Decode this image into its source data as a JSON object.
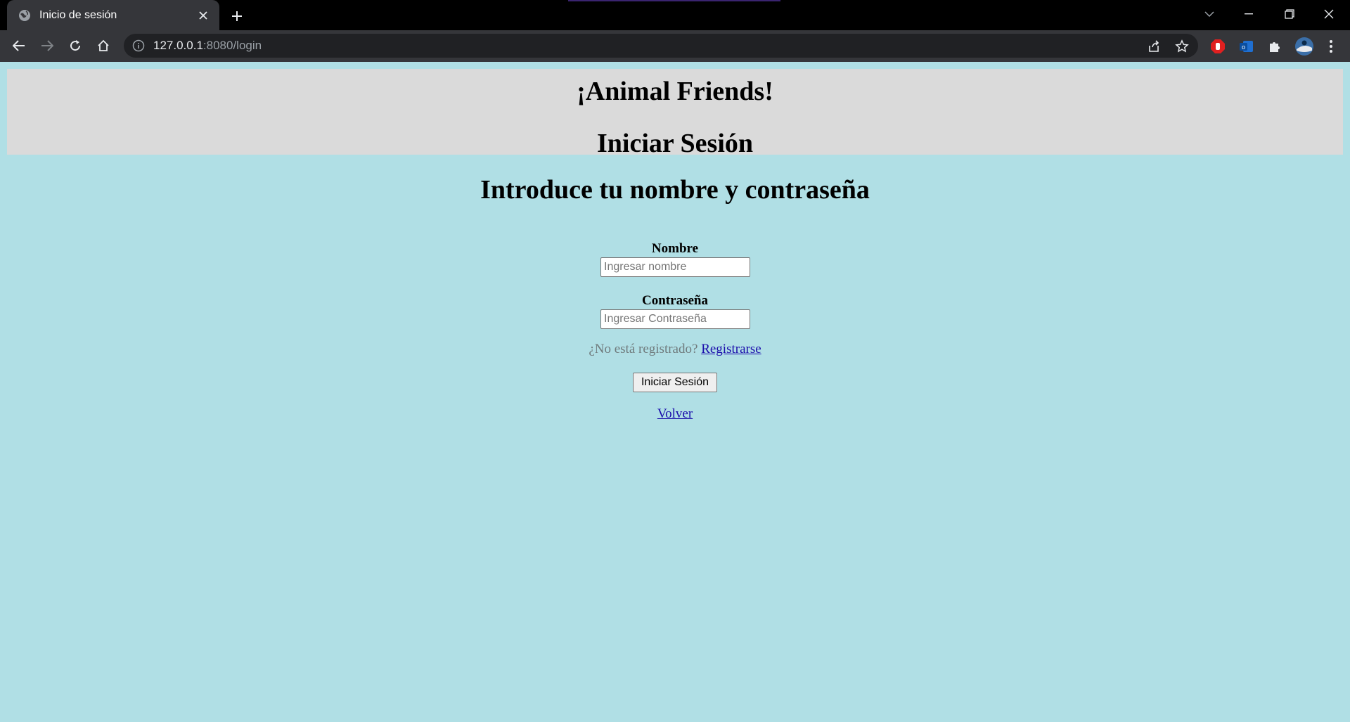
{
  "browser": {
    "tab_title": "Inicio de sesión",
    "url_host": "127.0.0.1",
    "url_rest": ":8080/login"
  },
  "page": {
    "site_title": "¡Animal Friends!",
    "heading": "Iniciar Sesión",
    "intro": "Introduce tu nombre y contraseña",
    "form": {
      "name_label": "Nombre",
      "name_placeholder": "Ingresar nombre",
      "password_label": "Contraseña",
      "password_placeholder": "Ingresar Contraseña",
      "not_registered_text": "¿No está registrado?",
      "register_link": "Registrarse",
      "submit_label": "Iniciar Sesión"
    },
    "back_link": "Volver"
  },
  "colors": {
    "page_background": "#b0dfe5",
    "header_background": "#dadada",
    "link": "#1a0dab"
  }
}
